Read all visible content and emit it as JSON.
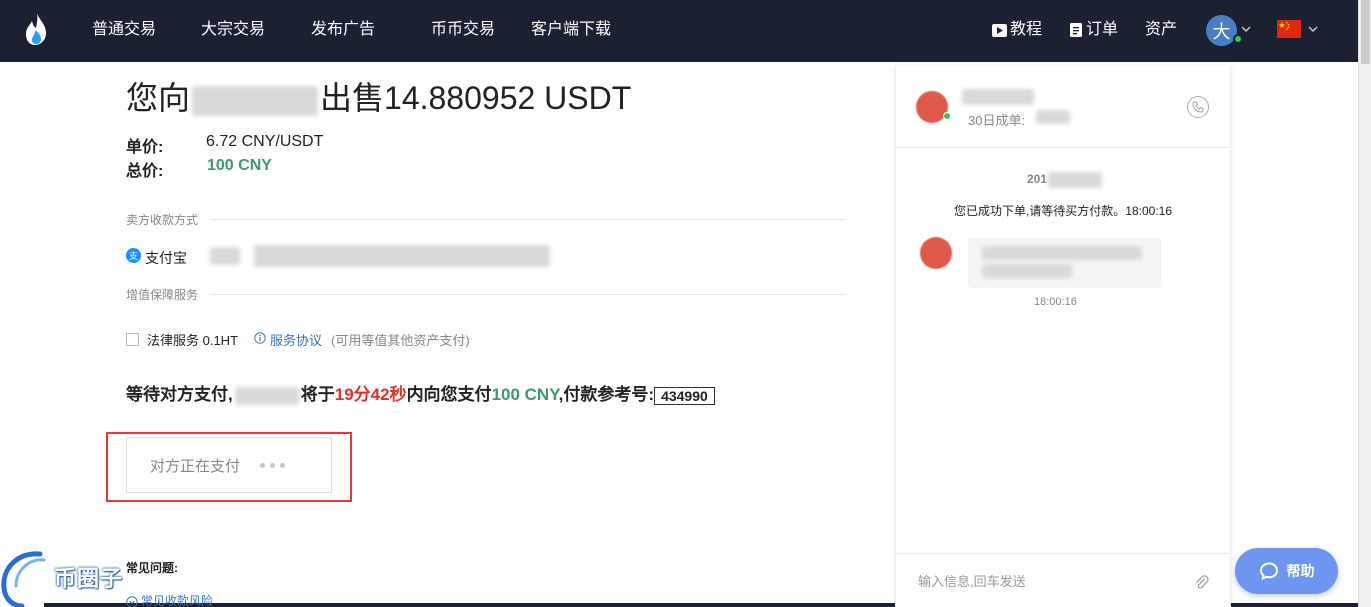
{
  "nav": {
    "items": [
      {
        "label": "普通交易"
      },
      {
        "label": "大宗交易"
      },
      {
        "label": "发布广告"
      },
      {
        "label": "币币交易"
      },
      {
        "label": "客户端下载"
      }
    ],
    "tutorial": "教程",
    "orders": "订单",
    "assets": "资产",
    "avatar_text": "大"
  },
  "order": {
    "title_prefix": "您向",
    "title_suffix": "出售14.880952 USDT",
    "unit_price_label": "单价:",
    "unit_price_value": "6.72 CNY/USDT",
    "total_label": "总价:",
    "total_value": "100 CNY"
  },
  "payment": {
    "section_label": "卖方收款方式",
    "method": "支付宝",
    "icon_char": "支"
  },
  "service": {
    "section_label": "增值保障服务",
    "legal_label": "法律服务 0.1HT",
    "agreement_link": "服务协议",
    "note": "(可用等值其他资产支付)"
  },
  "status": {
    "prefix": "等待对方支付,",
    "mid": "将于",
    "countdown": "19分42秒",
    "mid2": "内向您支付",
    "amount": "100 CNY",
    "ref_label": ",付款参考号:",
    "ref_no": "434990"
  },
  "pay_button": {
    "label": "对方正在支付"
  },
  "faq": {
    "title": "常见问题:",
    "item": "常见收款风险"
  },
  "watermark": {
    "text": "币圈子"
  },
  "chat": {
    "orders_30d_label": "30日成单:",
    "date_prefix": "201",
    "system_message": "您已成功下单,请等待买方付款。18:00:16",
    "bubble_time": "18:00:16",
    "input_placeholder": "输入信息,回车发送"
  },
  "help": {
    "label": "帮助"
  },
  "colors": {
    "nav_bg": "#1b2033",
    "green": "#3d9b6a",
    "red": "#e0302d",
    "link": "#3a74c4",
    "help_bg": "#6e95f0"
  }
}
